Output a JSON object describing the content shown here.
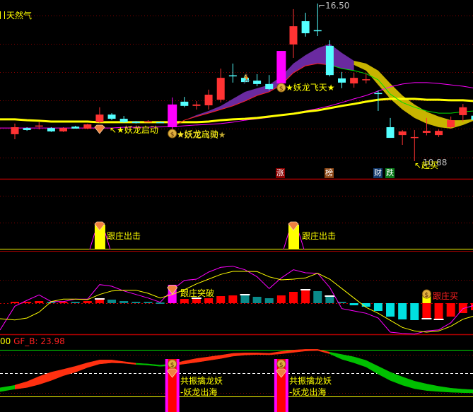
{
  "stock_name": "天然气",
  "high_label": "16.50",
  "low_label": "10.88",
  "main": {
    "price_high": 16.5,
    "price_low": 10.88,
    "candles": [
      [
        11.84,
        12.22,
        11.66,
        12.09,
        "up"
      ],
      [
        12.06,
        12.09,
        11.96,
        11.99,
        "down"
      ],
      [
        12.14,
        12.27,
        12.01,
        12.15,
        "up"
      ],
      [
        12.06,
        12.09,
        11.92,
        11.94,
        "down"
      ],
      [
        11.94,
        12.09,
        11.92,
        12.06,
        "up"
      ],
      [
        12.11,
        12.14,
        12.04,
        12.04,
        "down"
      ],
      [
        12.04,
        12.21,
        12.02,
        12.19,
        "up"
      ],
      [
        12.27,
        12.8,
        12.24,
        12.54,
        "up"
      ],
      [
        12.54,
        12.59,
        12.34,
        12.39,
        "down"
      ],
      [
        12.39,
        12.49,
        12.24,
        12.27,
        "down"
      ],
      [
        12.29,
        12.31,
        12.22,
        12.24,
        "down"
      ],
      [
        12.29,
        12.34,
        12.26,
        12.3,
        "up"
      ],
      [
        12.27,
        12.29,
        12.24,
        12.26,
        "down"
      ],
      [
        12.09,
        13.15,
        12.01,
        12.9,
        "signal"
      ],
      [
        13.0,
        13.17,
        12.8,
        12.85,
        "down"
      ],
      [
        12.85,
        13.02,
        12.72,
        12.9,
        "up"
      ],
      [
        12.87,
        13.43,
        12.72,
        13.25,
        "up"
      ],
      [
        13.07,
        14.18,
        12.97,
        13.85,
        "up"
      ],
      [
        13.94,
        14.36,
        13.68,
        13.93,
        "down"
      ],
      [
        13.85,
        13.95,
        13.7,
        13.7,
        "down"
      ],
      [
        13.75,
        13.98,
        13.55,
        13.63,
        "down"
      ],
      [
        13.63,
        13.95,
        13.4,
        13.45,
        "down"
      ],
      [
        13.65,
        14.81,
        13.6,
        14.81,
        "signal"
      ],
      [
        15.04,
        16.3,
        14.56,
        15.69,
        "up"
      ],
      [
        15.87,
        16.17,
        15.32,
        15.44,
        "down"
      ],
      [
        15.55,
        16.5,
        15.34,
        15.54,
        "down"
      ],
      [
        14.99,
        15.19,
        13.9,
        13.95,
        "down"
      ],
      [
        13.83,
        14.06,
        13.48,
        13.68,
        "down"
      ],
      [
        13.65,
        14.03,
        13.5,
        13.85,
        "up"
      ],
      [
        13.79,
        14.0,
        13.65,
        13.8,
        "up"
      ],
      [
        13.31,
        13.4,
        12.67,
        13.3,
        "down"
      ],
      [
        12.09,
        12.42,
        11.71,
        11.71,
        "down"
      ],
      [
        11.81,
        11.99,
        11.46,
        11.94,
        "up"
      ],
      [
        11.73,
        11.99,
        10.88,
        11.74,
        "up"
      ],
      [
        11.89,
        12.42,
        11.8,
        11.96,
        "up"
      ],
      [
        11.81,
        12.01,
        11.74,
        11.96,
        "up"
      ],
      [
        12.09,
        12.47,
        12.04,
        12.34,
        "up"
      ],
      [
        12.52,
        12.92,
        12.29,
        12.8,
        "up"
      ],
      [
        12.5,
        12.6,
        12.3,
        12.35,
        "down"
      ]
    ],
    "ma_yellow": [
      12.37,
      12.34,
      12.32,
      12.29,
      12.29,
      12.29,
      12.29,
      12.27,
      12.27,
      12.27,
      12.27,
      12.27,
      12.27,
      12.27,
      12.27,
      12.27,
      12.29,
      12.34,
      12.37,
      12.39,
      12.42,
      12.47,
      12.52,
      12.57,
      12.64,
      12.69,
      12.77,
      12.85,
      12.92,
      13.0,
      13.07,
      13.1,
      13.1,
      13.1,
      13.07,
      13.07,
      13.05,
      13.05,
      13.02
    ],
    "ma_magenta": [
      12.06,
      12.06,
      12.06,
      12.06,
      12.06,
      12.06,
      12.06,
      12.06,
      12.06,
      12.09,
      12.09,
      12.09,
      12.1,
      12.11,
      12.14,
      12.17,
      12.19,
      12.22,
      12.27,
      12.34,
      12.39,
      12.44,
      12.52,
      12.59,
      12.67,
      12.75,
      12.85,
      12.97,
      13.1,
      13.22,
      13.38,
      13.53,
      13.63,
      13.68,
      13.68,
      13.65,
      13.6,
      13.55,
      13.48
    ],
    "trend_line_start": 13,
    "trend_line": [
      12.09,
      12.34,
      12.47,
      12.59,
      12.72,
      12.85,
      13.02,
      13.22,
      13.35,
      13.6,
      14.03,
      14.28,
      14.36,
      14.31,
      14.18,
      14.11,
      14.0,
      13.78,
      13.27,
      12.97,
      12.8,
      12.67,
      12.59,
      12.59,
      12.64,
      12.67
    ],
    "trend_line_up_until": 26,
    "purple_band_start": 13,
    "purple_band_top": [
      12.19,
      12.34,
      12.52,
      12.67,
      12.85,
      13.1,
      13.35,
      13.48,
      13.6,
      13.9,
      14.36,
      14.66,
      14.91,
      15.06,
      14.74,
      14.46
    ],
    "yellow_band_start": 28,
    "yellow_band_top": [
      14.46,
      14.36,
      14.11,
      13.65,
      13.22,
      12.9,
      12.64,
      12.47,
      12.34,
      12.34,
      12.39
    ],
    "yellow_band_bottom": [
      14.31,
      14.11,
      13.6,
      13.1,
      12.72,
      12.42,
      12.22,
      12.09,
      12.04,
      12.17,
      12.34
    ],
    "signals": [
      {
        "index": 7,
        "icon": "diamond",
        "text": "↖★妖龙启动"
      },
      {
        "index": 13,
        "icon": "money-bag",
        "text": "★妖龙启动"
      },
      {
        "index": 13,
        "icon": "",
        "text": "★妖龙飞天★"
      },
      {
        "index": 19,
        "icon": "runner",
        "text": ""
      },
      {
        "index": 22,
        "icon": "money-bag",
        "text": "★妖龙飞天★"
      }
    ],
    "buy_label": "↖起买",
    "tags": [
      {
        "text": "涨",
        "color": "#8b0000"
      },
      {
        "text": "榜",
        "color": "#8b4513"
      },
      {
        "text": "财",
        "color": "#123a6e"
      },
      {
        "text": "跌",
        "color": "#0a7a1a"
      }
    ]
  },
  "panel2": {
    "signal_indices": [
      7,
      23
    ],
    "signal_text": "跟庄出击"
  },
  "panel3": {
    "bars": [
      2,
      2,
      3,
      2,
      2,
      2,
      3,
      5,
      5,
      3,
      2,
      2,
      1,
      26,
      6,
      6,
      7,
      10,
      11,
      11,
      9,
      7,
      11,
      16,
      18,
      17,
      9,
      2,
      -3,
      -5,
      -11,
      -19,
      -23,
      -24,
      -21,
      -22,
      -19,
      -14,
      -10
    ],
    "bar_types": [
      "red",
      "red",
      "red",
      "teal",
      "red",
      "teal",
      "red",
      "red",
      "teal",
      "teal",
      "teal",
      "teal",
      "teal",
      "signal",
      "red",
      "red",
      "red",
      "red",
      "red",
      "teal",
      "teal",
      "teal",
      "red",
      "red",
      "red",
      "teal",
      "teal",
      "teal",
      "cyan",
      "cyan",
      "cyan",
      "cyan",
      "cyan",
      "cyan",
      "red",
      "red",
      "red",
      "red",
      "red"
    ],
    "bar_caps": [
      7,
      15,
      19,
      24,
      26,
      34,
      35
    ],
    "line_magenta": [
      -4.3,
      4,
      11.7,
      2.3,
      2.3,
      5.7,
      5.7,
      26.3,
      24,
      17.3,
      12.3,
      7.3,
      1.3,
      19,
      32.3,
      34,
      44,
      50.7,
      52.3,
      47.3,
      37.3,
      20.7,
      35.7,
      47.3,
      43,
      42.3,
      22.3,
      -7.7,
      -11,
      -14.3,
      -21,
      -41,
      -42.7,
      -43.7,
      -39.3,
      -37.7,
      -27.7,
      -7.7,
      -2.7
    ],
    "line_yellow": [
      -23.7,
      -21,
      -12.7,
      2.3,
      5.7,
      5.7,
      5,
      12.3,
      17.3,
      18.3,
      18.3,
      14,
      7.3,
      12.3,
      19,
      27.3,
      34,
      40.7,
      45,
      45,
      44.7,
      37.3,
      33,
      34,
      35.7,
      42.3,
      34,
      20.7,
      7.3,
      -6,
      -14.3,
      -24.3,
      -34.3,
      -39.3,
      -41,
      -39.3,
      -32.7,
      -22.7,
      -17.7
    ],
    "signals": [
      {
        "index": 13,
        "icon": "diamond",
        "text": "跟庄突破",
        "color": "#ffff00"
      },
      {
        "index": 34,
        "icon": "money-bag",
        "text": "跟庄买",
        "color": "#ff2020"
      }
    ]
  },
  "panel4": {
    "header_prefix": "00",
    "header_label": "GF_B: 23.98",
    "ribbon_top": [
      24.4,
      32,
      43.1,
      52.3,
      58.4,
      65,
      72.6,
      78.7,
      78.7,
      75.1,
      71.6,
      70.1,
      67.5,
      70.1,
      76.6,
      81.7,
      85.3,
      88.8,
      92.9,
      93.9,
      93.9,
      92.9,
      97,
      100,
      101.5,
      101.5,
      95.4,
      90.4,
      85.3,
      77.7,
      65,
      52.3,
      42.1,
      33,
      26.9,
      21.8,
      17.8,
      15.7,
      14.2
    ],
    "ribbon_bottom": [
      15.7,
      19.3,
      25.9,
      34.5,
      44.7,
      52.3,
      62.4,
      70.1,
      72.6,
      71.6,
      69,
      67.5,
      65,
      66.5,
      70.1,
      73.6,
      77.7,
      81.7,
      86.8,
      89.3,
      90.4,
      89.8,
      91.9,
      94.9,
      98,
      99,
      91.9,
      80.2,
      72.6,
      63.5,
      48.2,
      34.5,
      24.4,
      16.8,
      12.7,
      10.7,
      9.1,
      8.1,
      7.6
    ],
    "ribbon_colors": [
      "red",
      "red",
      "red",
      "red",
      "red",
      "red",
      "red",
      "red",
      "red",
      "red",
      "green",
      "green",
      "green",
      "red",
      "red",
      "red",
      "red",
      "red",
      "red",
      "red",
      "red",
      "red",
      "red",
      "red",
      "red",
      "red",
      "green",
      "green",
      "green",
      "green",
      "green",
      "green",
      "green",
      "green",
      "green",
      "green",
      "green",
      "green",
      "green"
    ],
    "signal_indices": [
      13,
      22
    ],
    "signal_text_1": "共振擒龙妖",
    "signal_text_2": "妖龙出海"
  },
  "colors": {
    "up": "#ff3333",
    "down": "#54ffff",
    "signal": "#ff00ff",
    "teal": "#0a8a8a",
    "grid": "#8b0000"
  }
}
